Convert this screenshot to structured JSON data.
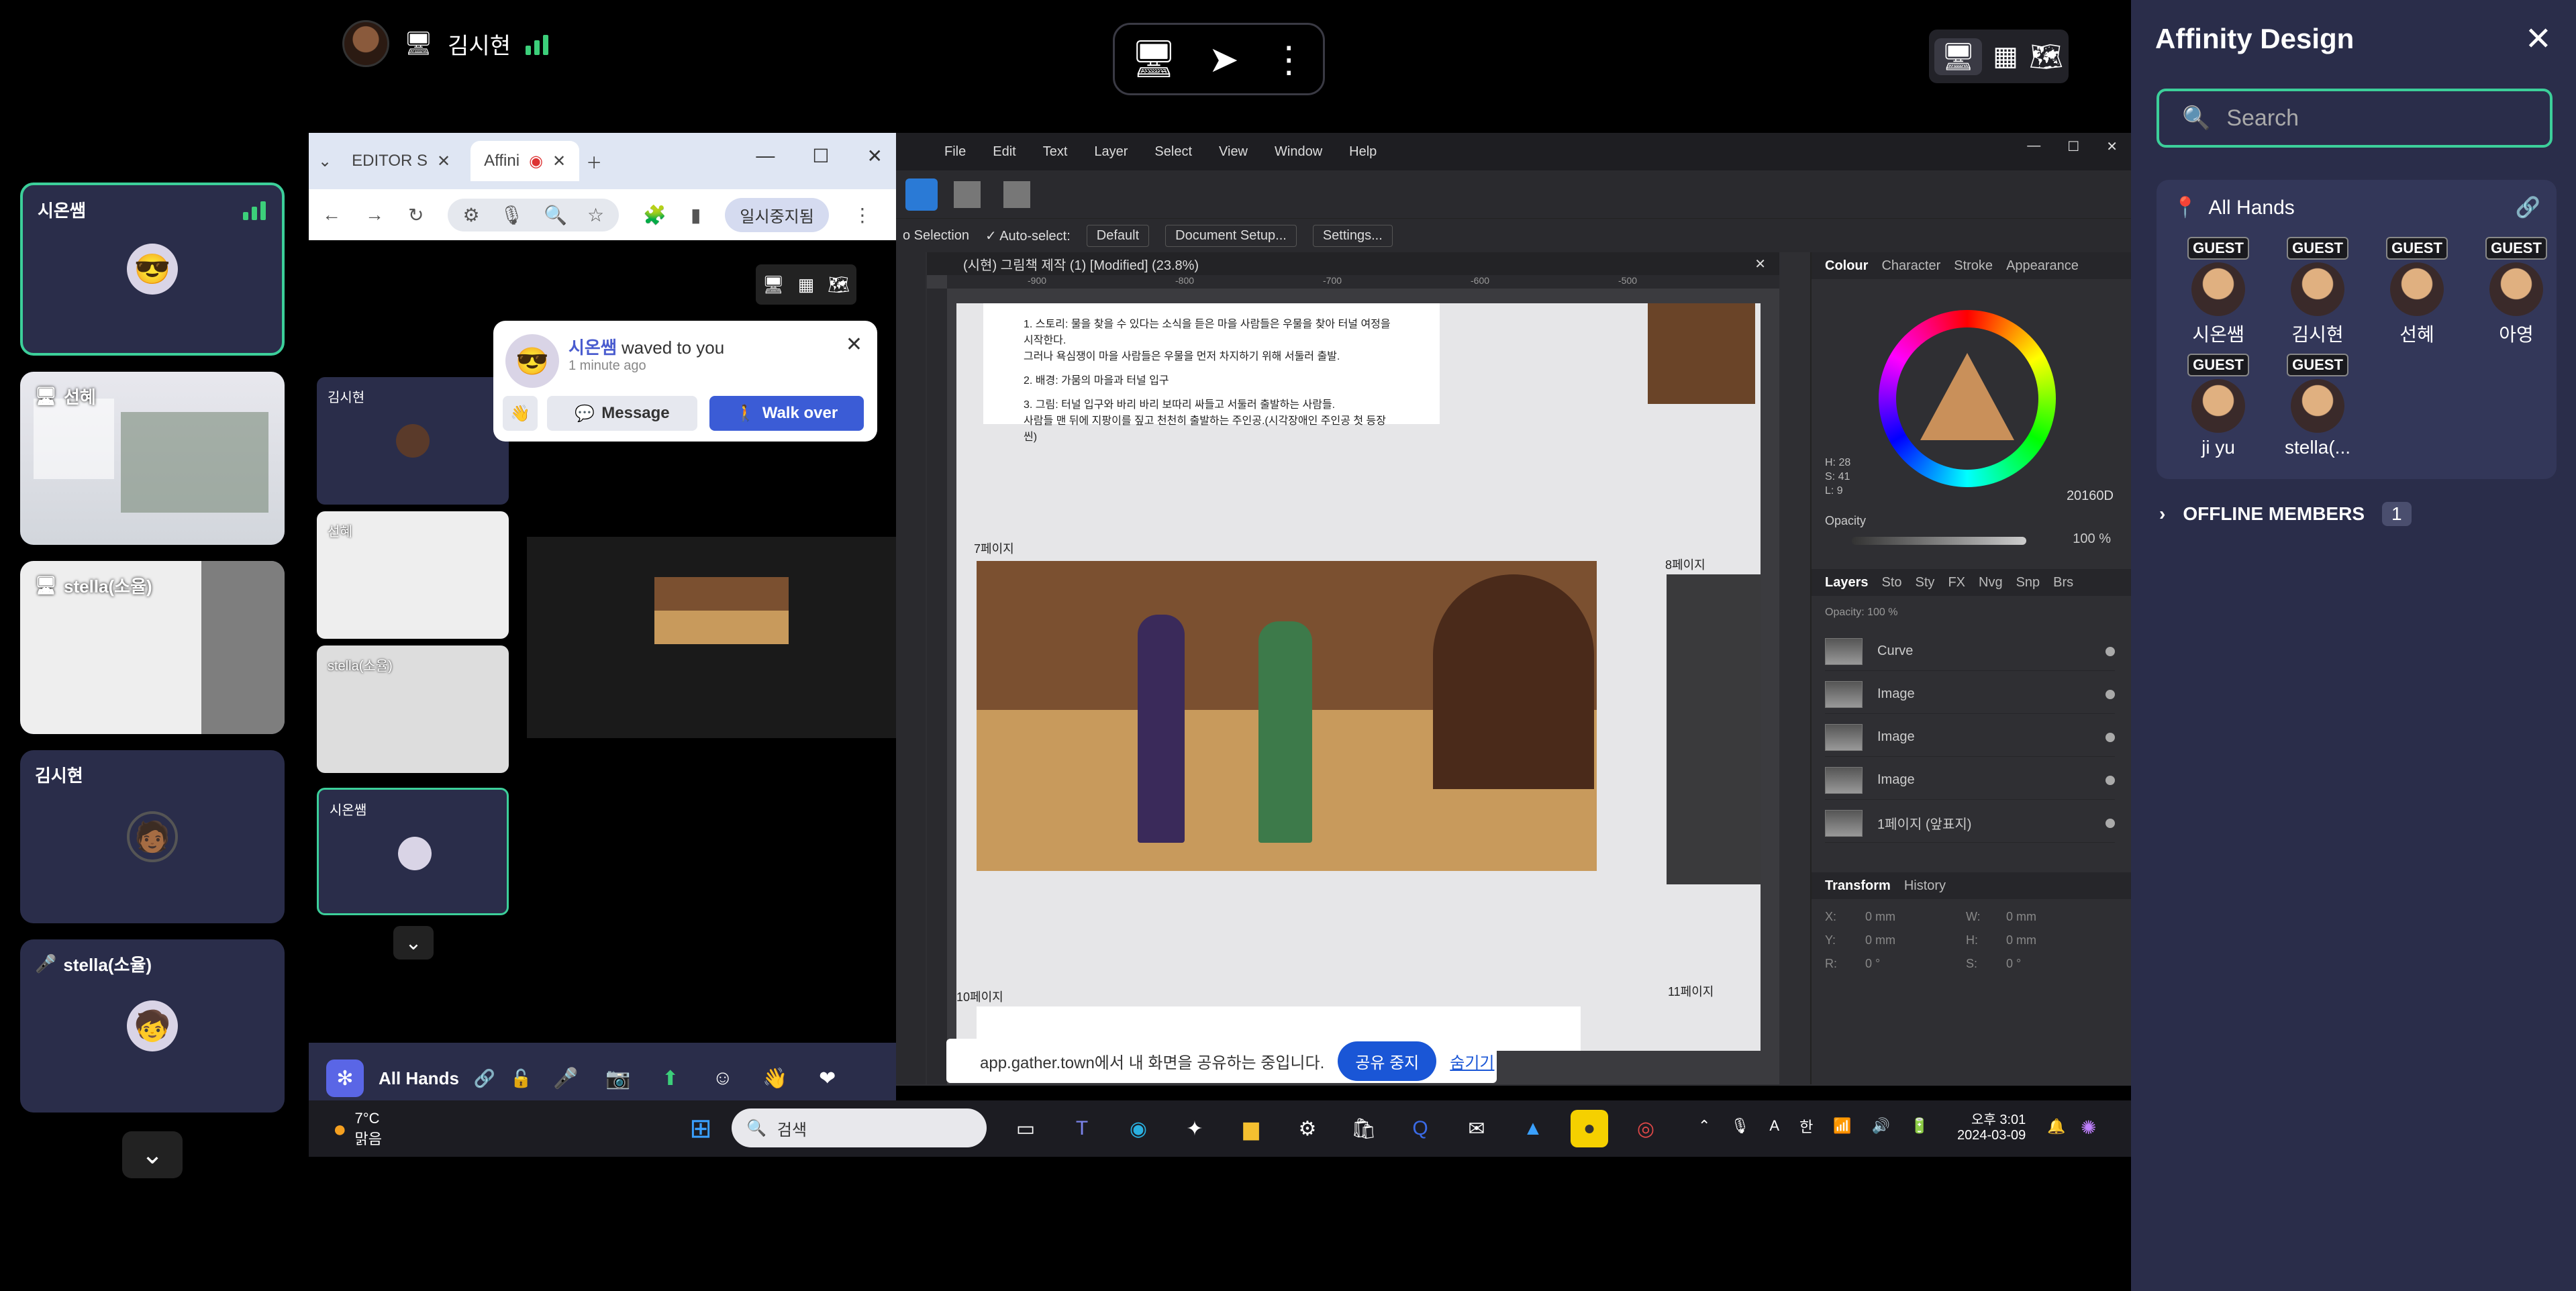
{
  "top": {
    "user_name": "김시현"
  },
  "left_tiles": [
    {
      "label": "시온쌤",
      "kind": "avatar"
    },
    {
      "label": "선혜",
      "kind": "screen"
    },
    {
      "label": "stella(소율)",
      "kind": "screen"
    },
    {
      "label": "김시현",
      "kind": "avatar"
    },
    {
      "label": "stella(소율)",
      "kind": "avatar-muted"
    }
  ],
  "browser": {
    "tab1": "EDITOR S",
    "tab2": "Affini",
    "pause_label": "일시중지됨"
  },
  "inner": {
    "tiles": [
      {
        "label": "김시현"
      },
      {
        "label": "선혜"
      },
      {
        "label": "stella(소율)"
      },
      {
        "label": "시온쌤"
      }
    ]
  },
  "wave": {
    "name": "시온쌤",
    "text": "waved to you",
    "time": "1 minute ago",
    "message_btn": "Message",
    "walk_btn": "Walk over"
  },
  "gather_bar": {
    "room": "All Hands"
  },
  "affinity": {
    "menu": [
      "File",
      "Edit",
      "Text",
      "Layer",
      "Select",
      "View",
      "Window",
      "Help"
    ],
    "ctx": {
      "selection": "o Selection",
      "autoselect": "Auto-select:",
      "default": "Default",
      "doc_setup": "Document Setup...",
      "settings": "Settings..."
    },
    "doc_title": "(시현) 그림책 제작 (1) [Modified] (23.8%)",
    "page_lines": [
      "1. 스토리: 물을 찾을 수 있다는 소식을 듣은 마을 사람들은 우물을 찾아 터널 여정을 시작한다.",
      "그러나 욕심쟁이 마을 사람들은 우물을 먼저 차지하기 위해 서둘러 출발.",
      "2. 배경: 가뭄의 마을과 터널 입구",
      "3. 그림: 터널 입구와 바리 바리 보따리 싸들고 서둘러 출발하는 사람들.",
      "사람들 맨 뒤에 지팡이를 짚고 천천히 출발하는 주인공.(시각장애인 주인공 첫 등장씬)"
    ],
    "page_labels": {
      "p7": "7페이지",
      "p8": "8페이지",
      "p10": "10페이지",
      "p11": "11페이지"
    },
    "ruler_ticks": [
      "-900",
      "-800",
      "-700",
      "-600",
      "-500"
    ],
    "color_tabs": [
      "Colour",
      "Character",
      "Stroke",
      "Appearance"
    ],
    "hsl": {
      "h": "H: 28",
      "s": "S: 41",
      "l": "L: 9"
    },
    "hex": "20160D",
    "opacity_label": "Opacity",
    "opacity": "100 %",
    "layer_tabs": [
      "Layers",
      "Sto",
      "Sty",
      "FX",
      "Nvg",
      "Snp",
      "Brs"
    ],
    "layer_opacity": "Opacity:  100 %",
    "layers": [
      "Curve",
      "Image",
      "Image",
      "Image",
      "1페이지 (앞표지)"
    ],
    "transform_tabs": [
      "Transform",
      "History"
    ],
    "transform": {
      "x": "X:",
      "y": "Y:",
      "w": "W:",
      "h": "H:",
      "r": "R:",
      "s": "S:",
      "x_val": "0 mm",
      "y_val": "0 mm",
      "w_val": "0 mm",
      "h_val": "0 mm",
      "r_val": "0 °",
      "s_val": "0 °"
    }
  },
  "share": {
    "text": "app.gather.town에서 내 화면을 공유하는 중입니다.",
    "stop": "공유 중지",
    "hide": "숨기기"
  },
  "taskbar": {
    "weather_temp": "7°C",
    "weather_desc": "맑음",
    "search": "검색",
    "time": "오후 3:01",
    "date": "2024-03-09",
    "lang": "한",
    "font_a": "A"
  },
  "right_panel": {
    "title": "Affinity Design",
    "search_placeholder": "Search",
    "room": "All Hands",
    "badge": "GUEST",
    "members": [
      "시온쌤",
      "김시현",
      "선혜",
      "아영",
      "ji yu",
      "stella(..."
    ],
    "offline_label": "OFFLINE MEMBERS",
    "offline_count": "1"
  }
}
